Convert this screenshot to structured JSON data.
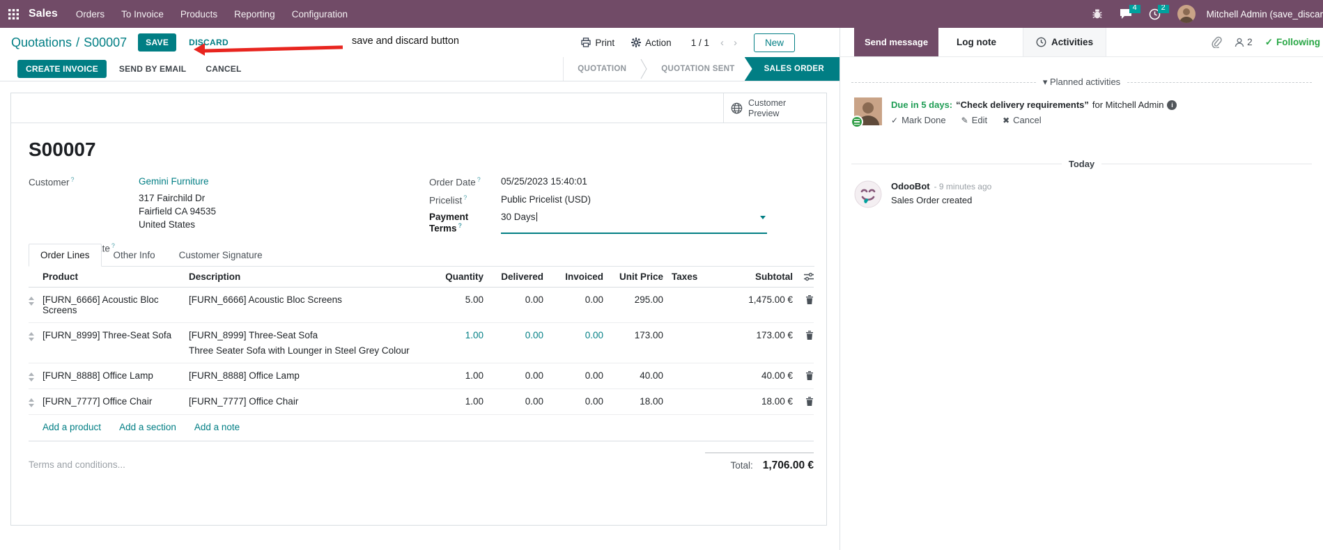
{
  "nav": {
    "app_name": "Sales",
    "menus": [
      "Orders",
      "To Invoice",
      "Products",
      "Reporting",
      "Configuration"
    ],
    "messages_badge": "4",
    "activities_badge": "2",
    "user": "Mitchell Admin (save_discar",
    "colors": {
      "bar": "#714B67",
      "badge": "#00A09D"
    }
  },
  "control_panel": {
    "breadcrumb_parent": "Quotations",
    "breadcrumb_sep": "/",
    "breadcrumb_current": "S00007",
    "save_label": "SAVE",
    "discard_label": "DISCARD",
    "annotation_text": "save and discard button",
    "annotation_color": "#e8251f",
    "print_label": "Print",
    "action_label": "Action",
    "pager": "1 / 1",
    "pager_prev": "‹",
    "pager_next": "›",
    "new_label": "New"
  },
  "statusbar": {
    "buttons": [
      "CREATE INVOICE",
      "SEND BY EMAIL",
      "CANCEL"
    ],
    "steps": [
      {
        "label": "QUOTATION",
        "active": false
      },
      {
        "label": "QUOTATION SENT",
        "active": false
      },
      {
        "label": "SALES ORDER",
        "active": true
      }
    ],
    "active_color": "#017E84"
  },
  "form": {
    "customer_preview_label": "Customer Preview",
    "title": "S00007",
    "help_marker": "?",
    "fields": {
      "customer_label": "Customer",
      "customer_value": "Gemini Furniture",
      "address_line1": "317 Fairchild Dr",
      "address_line2": "Fairfield CA 94535",
      "address_line3": "United States",
      "quotation_template_label": "Quotation Template",
      "order_date_label": "Order Date",
      "order_date_value": "05/25/2023 15:40:01",
      "pricelist_label": "Pricelist",
      "pricelist_value": "Public Pricelist (USD)",
      "payment_terms_label": "Payment Terms",
      "payment_terms_value": "30 Days"
    },
    "tabs": [
      {
        "label": "Order Lines",
        "active": true
      },
      {
        "label": "Other Info",
        "active": false
      },
      {
        "label": "Customer Signature",
        "active": false
      }
    ],
    "table": {
      "headers": [
        "Product",
        "Description",
        "Quantity",
        "Delivered",
        "Invoiced",
        "Unit Price",
        "Taxes",
        "Subtotal"
      ],
      "rows": [
        {
          "product": "[FURN_6666] Acoustic Bloc Screens",
          "description": "[FURN_6666] Acoustic Bloc Screens",
          "description2": "",
          "quantity": "5.00",
          "delivered": "0.00",
          "invoiced": "0.00",
          "unit_price": "295.00",
          "taxes": "",
          "subtotal": "1,475.00 €"
        },
        {
          "product": "[FURN_8999] Three-Seat Sofa",
          "description": "[FURN_8999] Three-Seat Sofa",
          "description2": "Three Seater Sofa with Lounger in Steel Grey Colour",
          "quantity": "1.00",
          "delivered": "0.00",
          "invoiced": "0.00",
          "unit_price": "173.00",
          "taxes": "",
          "subtotal": "173.00 €"
        },
        {
          "product": "[FURN_8888] Office Lamp",
          "description": "[FURN_8888] Office Lamp",
          "description2": "",
          "quantity": "1.00",
          "delivered": "0.00",
          "invoiced": "0.00",
          "unit_price": "40.00",
          "taxes": "",
          "subtotal": "40.00 €"
        },
        {
          "product": "[FURN_7777] Office Chair",
          "description": "[FURN_7777] Office Chair",
          "description2": "",
          "quantity": "1.00",
          "delivered": "0.00",
          "invoiced": "0.00",
          "unit_price": "18.00",
          "taxes": "",
          "subtotal": "18.00 €"
        }
      ],
      "footer_links": [
        "Add a product",
        "Add a section",
        "Add a note"
      ]
    },
    "terms_placeholder": "Terms and conditions...",
    "total_label": "Total:",
    "total_value": "1,706.00 €"
  },
  "chatter": {
    "send_message_label": "Send message",
    "log_note_label": "Log note",
    "activities_label": "Activities",
    "followers_count": "2",
    "following_label": "Following",
    "planned_title": "Planned activities",
    "planned_caret": "▾",
    "activity": {
      "due_text": "Due in 5 days:",
      "summary": "“Check delivery requirements”",
      "assignee_text": "for Mitchell Admin",
      "mark_done_label": "Mark Done",
      "edit_label": "Edit",
      "cancel_label": "Cancel"
    },
    "today_label": "Today",
    "message": {
      "author": "OdooBot",
      "time": "- 9 minutes ago",
      "body": "Sales Order created"
    }
  }
}
